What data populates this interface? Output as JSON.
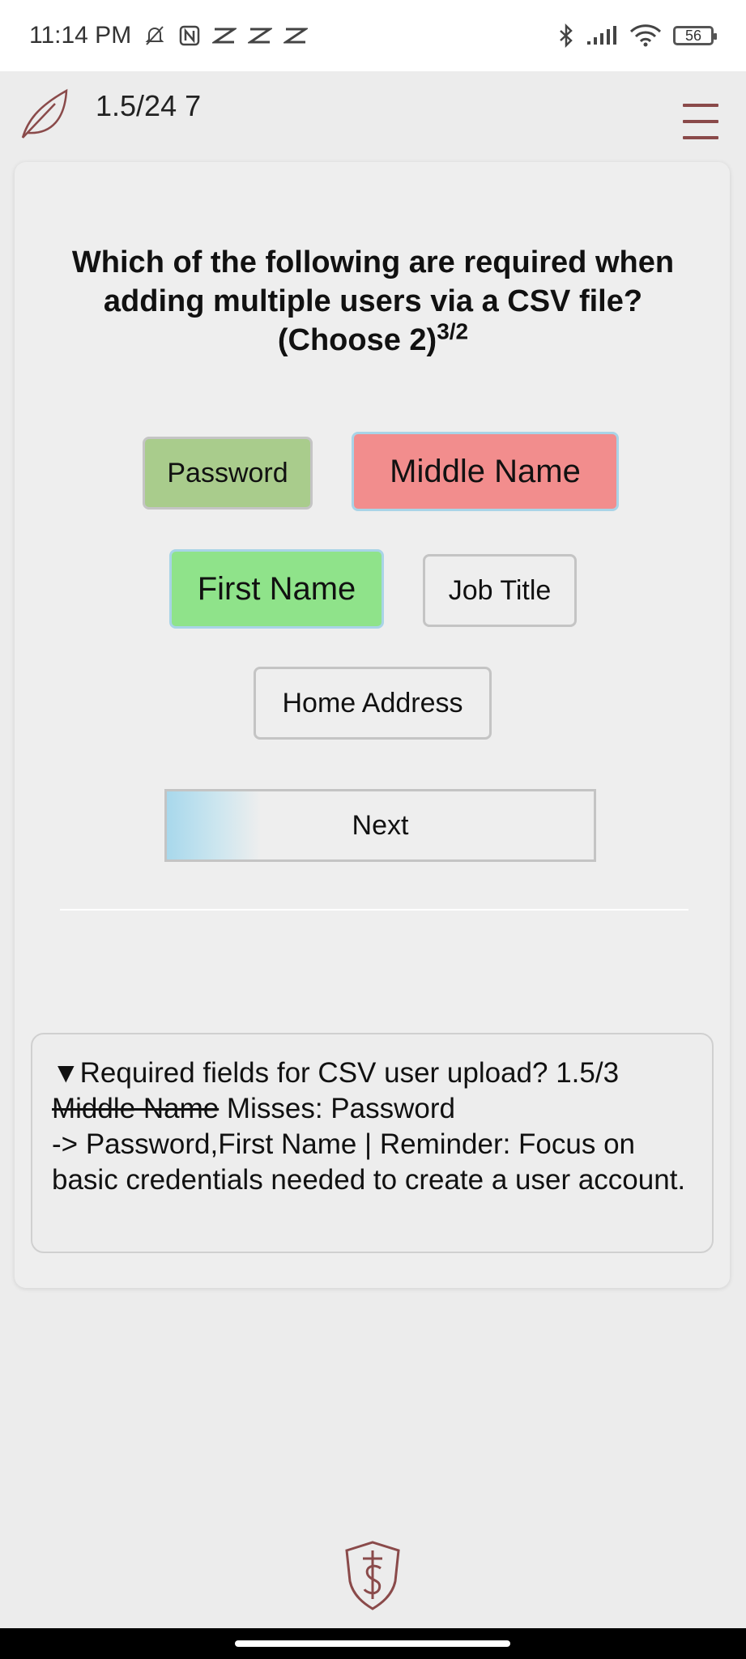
{
  "status_bar": {
    "time": "11:14 PM",
    "battery_level": "56",
    "left_icons": [
      "mute-alarm-icon",
      "nfc-icon",
      "capcut-icon",
      "capcut-icon",
      "capcut-icon"
    ],
    "right_icons": [
      "bluetooth-icon",
      "signal-icon",
      "wifi-icon",
      "battery-icon"
    ]
  },
  "header": {
    "progress": "1.5/24 7",
    "accent_color": "#8a4a4a"
  },
  "question": {
    "text": "Which of the following are required when adding multiple users via a CSV file? (Choose 2)",
    "superscript": "3/2"
  },
  "options": [
    {
      "label": "Password",
      "state": "correct-selected-dim",
      "color": "#a9cc8c"
    },
    {
      "label": "Middle Name",
      "state": "wrong-selected",
      "color": "#f28d8d"
    },
    {
      "label": "First Name",
      "state": "correct-selected",
      "color": "#8fe38a"
    },
    {
      "label": "Job Title",
      "state": "unselected",
      "color": "#eeeeee"
    },
    {
      "label": "Home Address",
      "state": "unselected",
      "color": "#eeeeee"
    }
  ],
  "next_button": {
    "label": "Next",
    "progress_fraction": 0.22
  },
  "feedback": {
    "summary_marker": "▼",
    "summary": "Required fields for CSV user upload? 1.5/3",
    "wrong_choice": "Middle Name",
    "misses": " Misses: Password",
    "answer_line": "-> Password,First Name | Reminder: Focus on basic credentials needed to create a user account."
  }
}
